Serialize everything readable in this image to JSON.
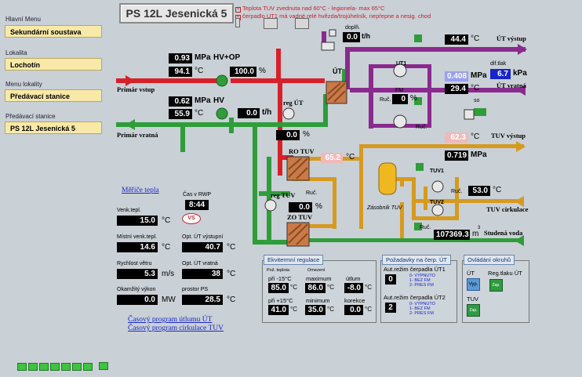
{
  "sidebar": {
    "items": [
      {
        "caption": "Hlavní Menu",
        "value": "Sekundární soustava"
      },
      {
        "caption": "Lokalita",
        "value": "Lochotín"
      },
      {
        "caption": "Menu lokality",
        "value": "Předávací stanice"
      },
      {
        "caption": "Předávací stanice",
        "value": "PS 12L Jesenická 5"
      }
    ]
  },
  "header": {
    "title": "PS 12L Jesenická 5",
    "alarms": [
      "Teplota TUV zvednuta nad 60°C - legionela- max 65°C",
      "čerpadlo UT1 má vadné relé hvězda/trojúhelník, nepřepne a nesig. chod"
    ]
  },
  "primary": {
    "supply_label": "Primár vstup",
    "return_label": "Primár vratná",
    "hv_op_pressure": "0.93",
    "hv_op_temp": "94.1",
    "hv_op_valve": "100.0",
    "hv_op_label": "HV+OP",
    "hv_pressure": "0.62",
    "hv_temp": "55.9",
    "hv_label": "HV",
    "flow": "0.0",
    "flow_unit": "t/h"
  },
  "ut": {
    "label": "ÚT",
    "dopln_label": "doplň.",
    "dopln_flow": "0.0",
    "dopln_unit": "t/h",
    "reg_label": "reg ÚT",
    "reg_value": "0.0",
    "out_temp": "44.4",
    "out_label": "ÚT výstup",
    "return_pressure": "0.408",
    "dif_label": "dif.tlak",
    "dif_value": "6.7",
    "return_temp": "29.4",
    "return_label": "ÚT vratná",
    "pump_label": "UT1",
    "fm_label": "FM",
    "fm_value": "0",
    "so_label": "so",
    "ruc_label": "Ruč."
  },
  "tuv": {
    "ro_label": "RO TUV",
    "ro_temp": "65.2",
    "zo_label": "ZO TUV",
    "reg_label": "reg TUV",
    "reg_value": "0.0",
    "out_temp": "62.3",
    "out_label": "TUV výstup",
    "out_pressure": "0.719",
    "tank_label": "Zásobník TUV",
    "circ_temp": "53.0",
    "circ_label": "TUV cirkulace",
    "pump1_label": "TUV1",
    "pump2_label": "TUV2",
    "cold_water": "107369.3",
    "cold_unit": "m",
    "cold_label": "Studená voda"
  },
  "measurements": {
    "link": "Měřiče tepla",
    "rwp_label": "Čas v RWP",
    "rwp_value": "8:44",
    "outdoor_label": "Venk.tepl.",
    "outdoor_value": "15.0",
    "local_label": "Místní venk.tepl.",
    "local_value": "14.6",
    "opt_out_label": "Opt. ÚT výstupní",
    "opt_out_value": "40.7",
    "wind_label": "Rychlost větru",
    "wind_value": "5.3",
    "wind_unit": "m/s",
    "opt_ret_label": "Opt. ÚT vratná",
    "opt_ret_value": "38",
    "power_label": "Okamžitý výkon",
    "power_value": "0.0",
    "power_unit": "MW",
    "ps_label": "prostor PS",
    "ps_value": "28.5",
    "vs_label": "VS",
    "link_ut": "Časový program útlumu ÚT",
    "link_tuv": "Časový program cirkulace TUV"
  },
  "eq_panel": {
    "tab": "Ekvitermní regulace",
    "col1": "Pož. teplota",
    "col2": "Omezení",
    "r1_label": "při -15°C",
    "r1_value": "85.0",
    "max_label": "maximum",
    "max_value": "86.0",
    "utlum_label": "útlum",
    "utlum_value": "-8.0",
    "r2_label": "při +15°C",
    "r2_value": "41.0",
    "min_label": "minimum",
    "min_value": "35.0",
    "kor_label": "korekce",
    "kor_value": "0.0"
  },
  "req_panel": {
    "tab": "Požadavky na čerp. ÚT",
    "p1_label": "Aut.režim čerpadla ÚT1",
    "p1_value": "0",
    "p2_label": "Aut.režim čerpadla ÚT2",
    "p2_value": "2",
    "legend": [
      "0- VYPNUTO",
      "1- BEZ FM",
      "2- PRES FM"
    ]
  },
  "ctrl_panel": {
    "tab": "Ovládání okruhů",
    "ut_label": "ÚT",
    "ut_btn": "Vyp.",
    "reg_label": "Reg.tlaku ÚT",
    "reg_btn": "Zap.",
    "tuv_label": "TUV",
    "tuv_btn": "Zap."
  },
  "units": {
    "mpa": "MPa",
    "c": "°C",
    "pct": "%",
    "kpa": "kPa"
  },
  "colors": {
    "background": "#c9d0d6",
    "primary_supply": "#d8202a",
    "primary_return": "#2f9d3a",
    "heating_circuit": "#8a2a8e",
    "dhw_circuit": "#d69a1e"
  }
}
